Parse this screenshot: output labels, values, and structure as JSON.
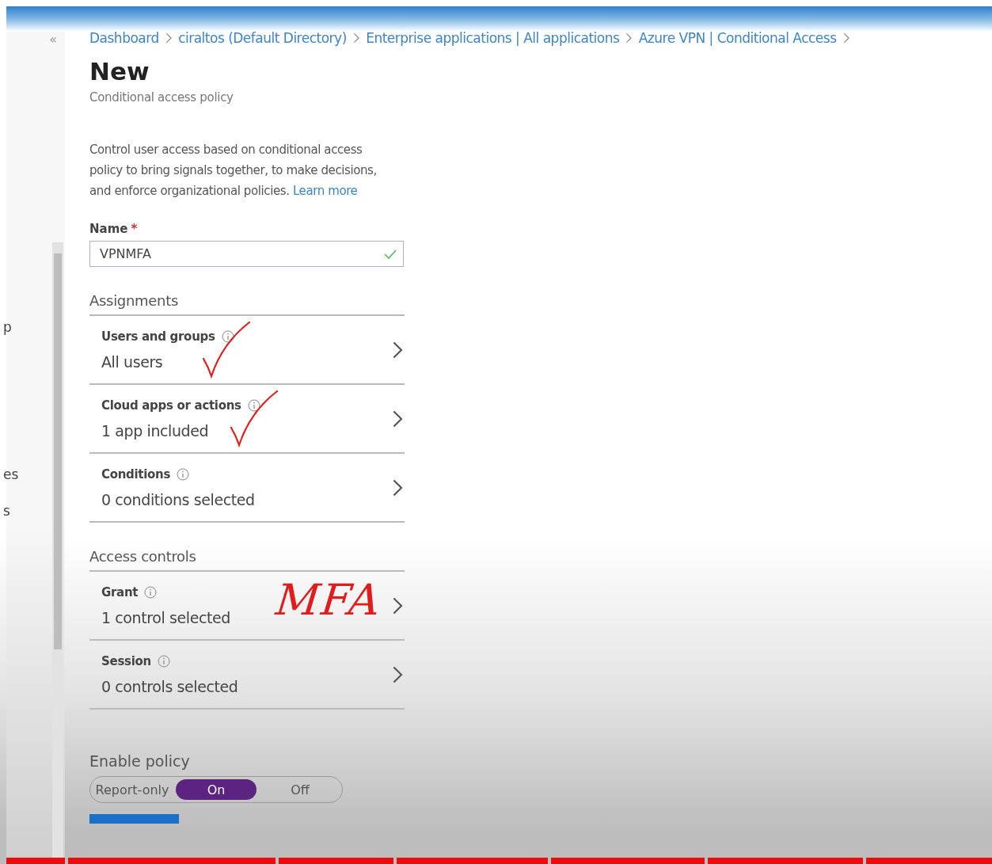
{
  "sidebar": {
    "collapse": "«",
    "items": [
      "p",
      "es",
      "s"
    ]
  },
  "breadcrumb": [
    "Dashboard",
    "ciraltos (Default Directory)",
    "Enterprise applications | All applications",
    "Azure VPN | Conditional Access"
  ],
  "title": "New",
  "subtitle": "Conditional access policy",
  "description": "Control user access based on conditional access policy to bring signals together, to make decisions, and enforce organizational policies.",
  "learn_more": "Learn more",
  "name_field": {
    "label": "Name",
    "required_mark": "*",
    "value": "VPNMFA",
    "valid": true
  },
  "sections": [
    {
      "title": "Assignments",
      "rows": [
        {
          "label": "Users and groups",
          "value": "All users",
          "annotation": {
            "kind": "check"
          }
        },
        {
          "label": "Cloud apps or actions",
          "value": "1 app included",
          "annotation": {
            "kind": "check"
          }
        },
        {
          "label": "Conditions",
          "value": "0 conditions selected"
        }
      ]
    },
    {
      "title": "Access controls",
      "rows": [
        {
          "label": "Grant",
          "value": "1 control selected",
          "annotation": {
            "kind": "text",
            "text": "MFA"
          }
        },
        {
          "label": "Session",
          "value": "0 controls selected"
        }
      ]
    }
  ],
  "enable_policy": {
    "label": "Enable policy",
    "options": [
      {
        "label": "Report-only",
        "selected": false
      },
      {
        "label": "On",
        "selected": true
      },
      {
        "label": "Off",
        "selected": false
      }
    ]
  }
}
